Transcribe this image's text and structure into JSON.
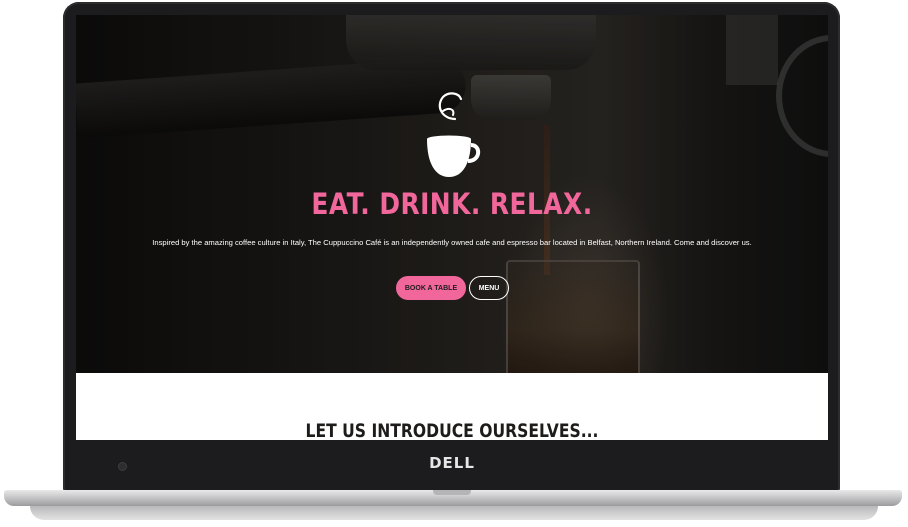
{
  "device": {
    "brand": "DELL"
  },
  "hero": {
    "title": "EAT. DRINK. RELAX.",
    "description": "Inspired by the amazing coffee culture in Italy, The Cuppuccino Café is an independently owned cafe and espresso bar located in Belfast, Northern Ireland. Come and discover us.",
    "book_label": "BOOK A TABLE",
    "menu_label": "MENU"
  },
  "intro": {
    "heading": "LET US INTRODUCE OURSELVES..."
  },
  "colors": {
    "accent": "#f2679b",
    "dark": "#1d1c1b",
    "bezel": "#1c1c1e"
  },
  "icons": {
    "logo": "coffee-cup-logo-icon",
    "camera": "webcam-icon"
  }
}
